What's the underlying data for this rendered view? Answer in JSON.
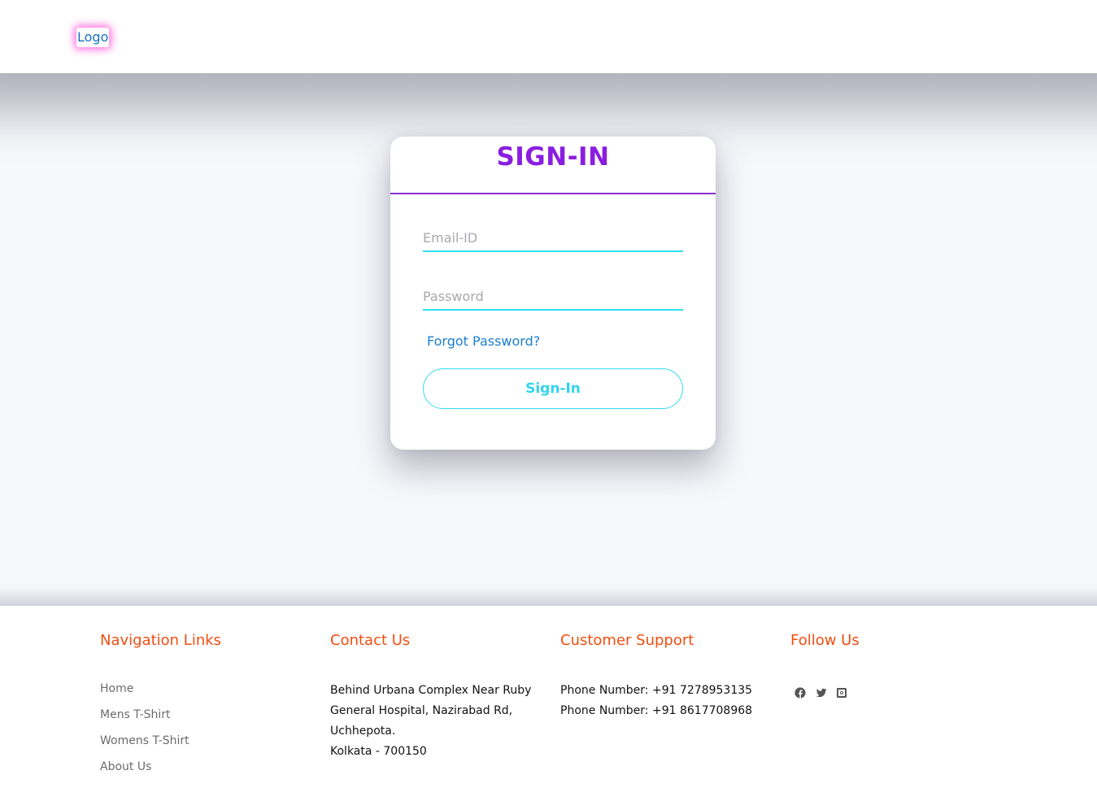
{
  "header": {
    "logo": "Logo"
  },
  "signin": {
    "title": "SIGN-IN",
    "email_placeholder": "Email-ID",
    "password_placeholder": "Password",
    "forgot": "Forgot Password?",
    "button": "Sign-In"
  },
  "footer": {
    "nav": {
      "title": "Navigation Links",
      "links": [
        "Home",
        "Mens T-Shirt",
        "Womens T-Shirt",
        "About Us"
      ]
    },
    "contact": {
      "title": "Contact Us",
      "lines": [
        "Behind Urbana Complex Near Ruby",
        "General Hospital, Nazirabad Rd,",
        "Uchhepota.",
        "Kolkata - 700150"
      ]
    },
    "support": {
      "title": "Customer Support",
      "lines": [
        "Phone Number: +91 7278953135",
        "Phone Number: +91 8617708968"
      ]
    },
    "follow": {
      "title": "Follow Us",
      "icons": [
        "facebook-icon",
        "twitter-icon",
        "instagram-icon"
      ]
    }
  },
  "colors": {
    "title_purple": "#8a1ee0",
    "accent_cyan": "#2ee0f0",
    "footer_heading": "#f04e12",
    "link_blue": "#1a7fcf"
  }
}
